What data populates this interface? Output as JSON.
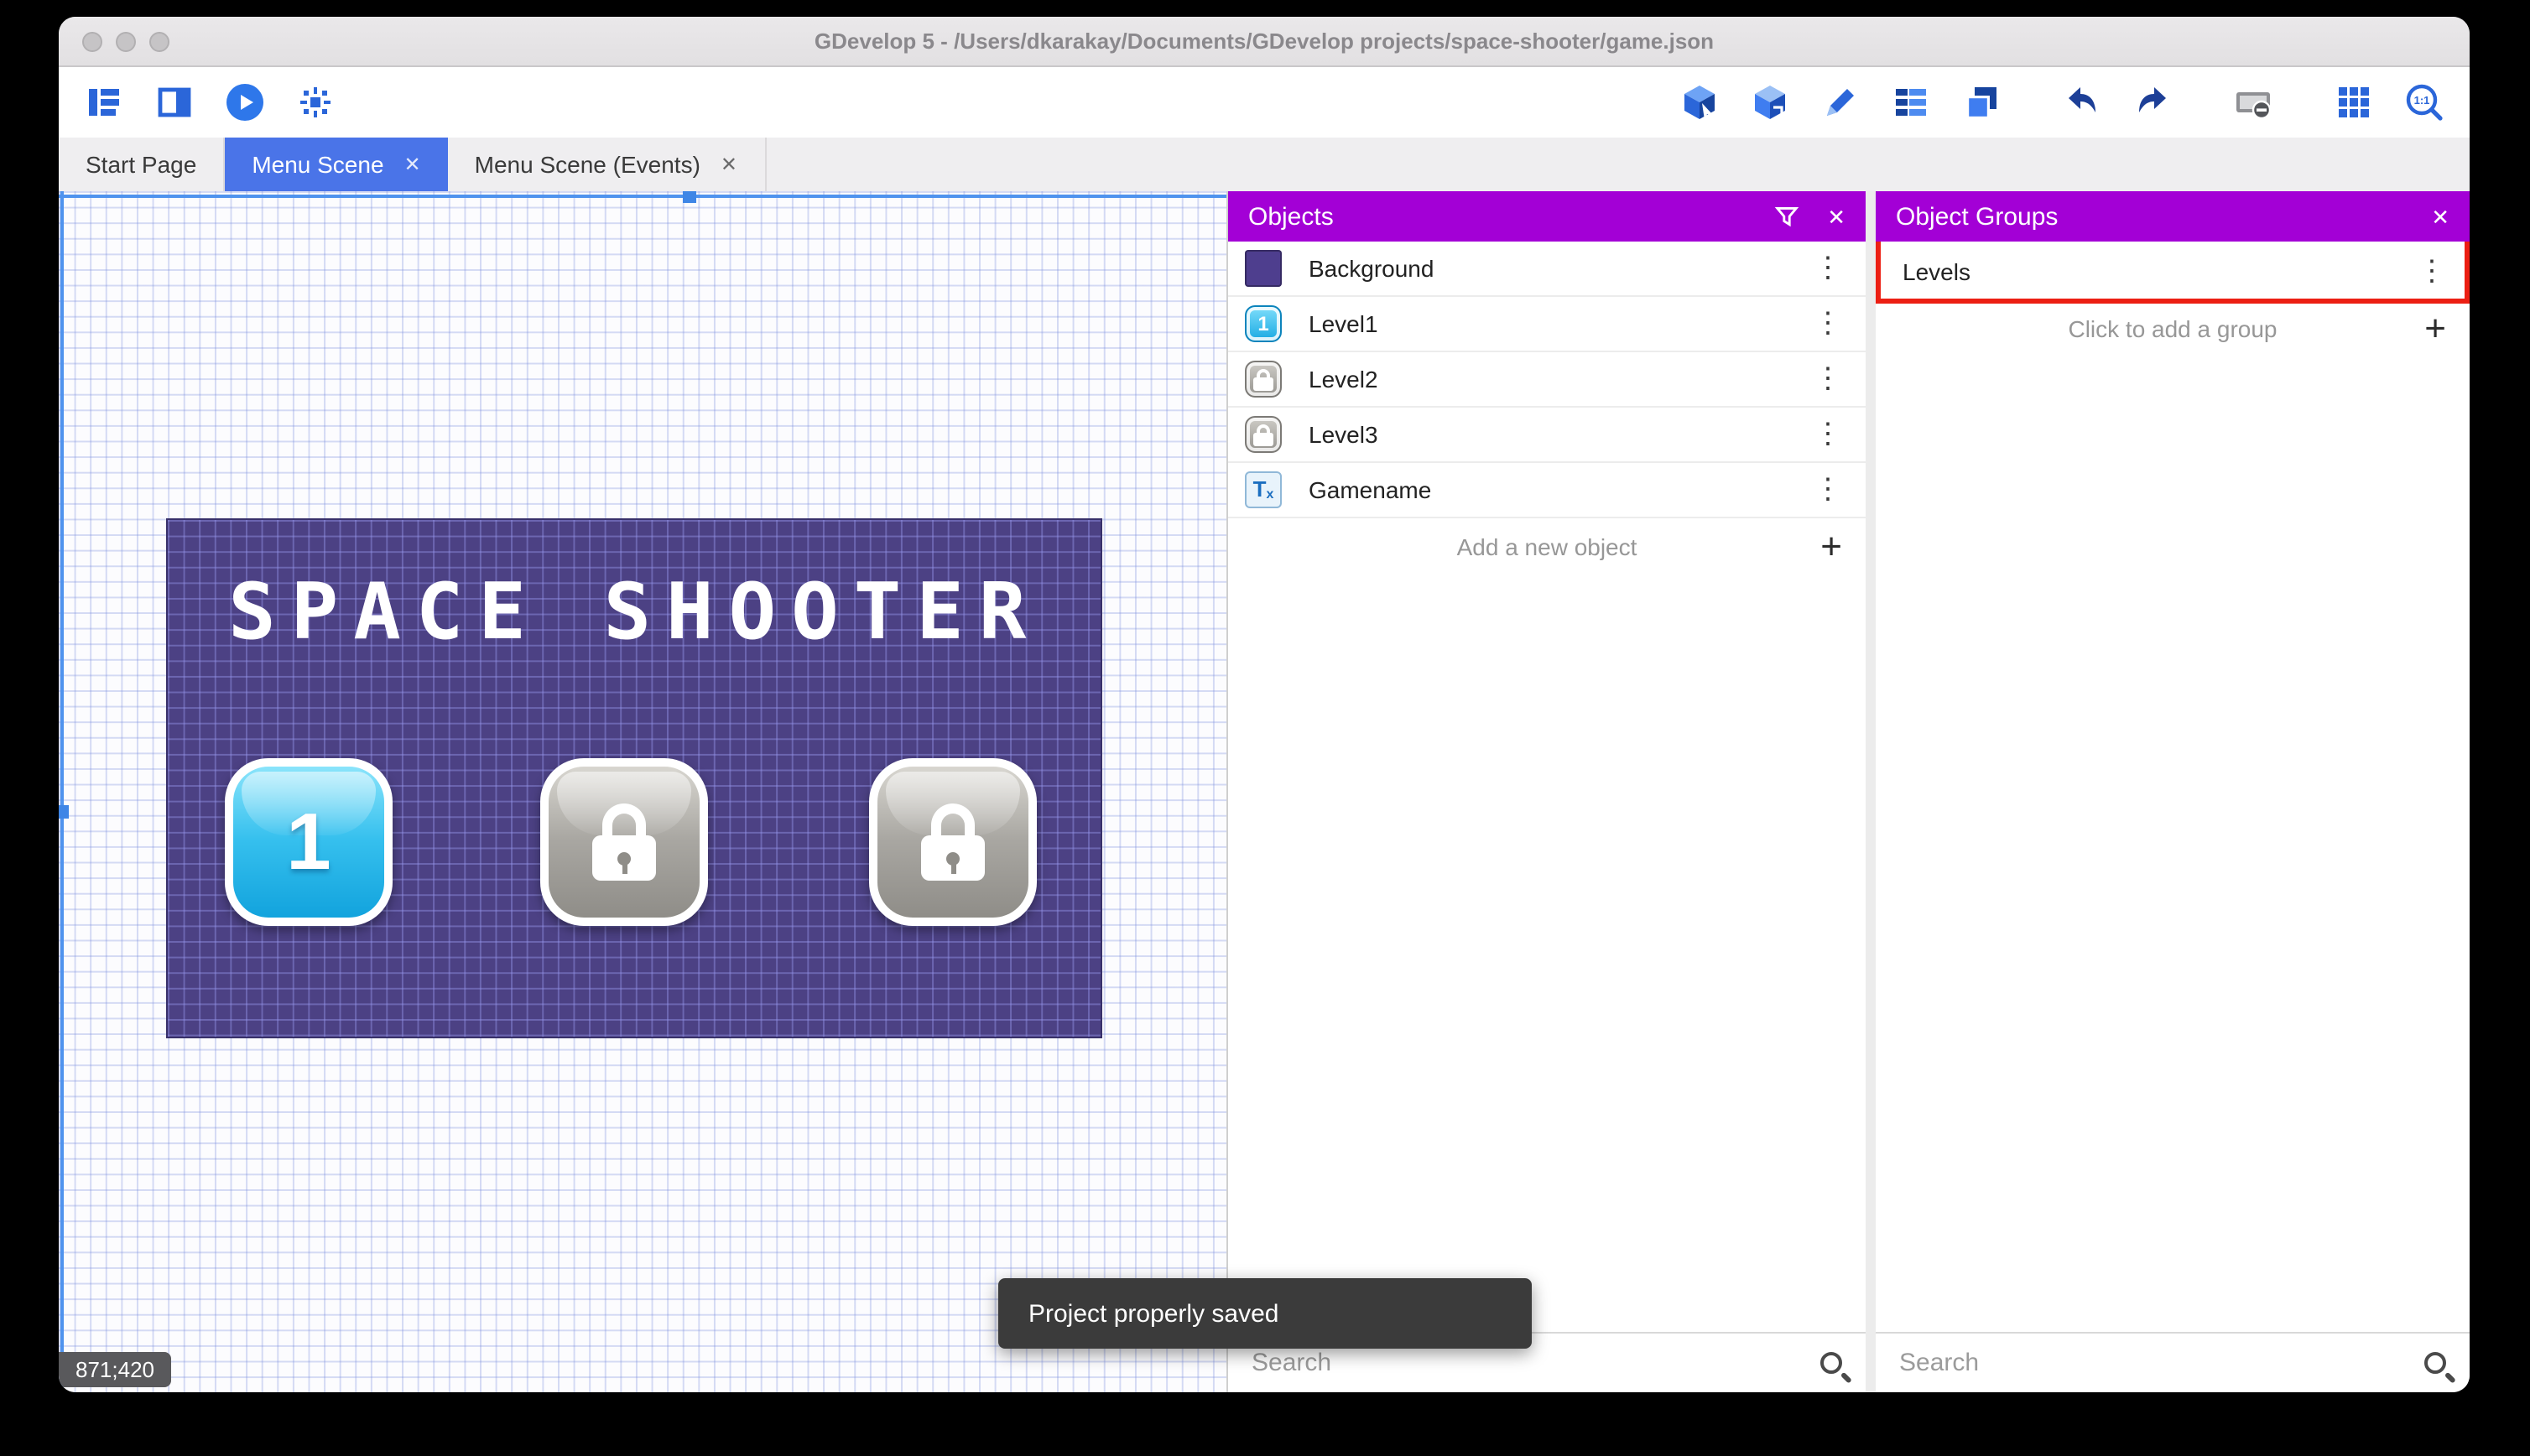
{
  "titlebar": {
    "title": "GDevelop 5 - /Users/dkarakay/Documents/GDevelop projects/space-shooter/game.json"
  },
  "tabs": {
    "items": [
      {
        "label": "Start Page"
      },
      {
        "label": "Menu Scene"
      },
      {
        "label": "Menu Scene (Events)"
      }
    ]
  },
  "canvas": {
    "coordinates": "871;420"
  },
  "scene": {
    "title": "SPACE SHOOTER",
    "level1_label": "1"
  },
  "objects_panel": {
    "title": "Objects",
    "items": [
      {
        "label": "Background"
      },
      {
        "label": "Level1",
        "badge": "1"
      },
      {
        "label": "Level2"
      },
      {
        "label": "Level3"
      },
      {
        "label": "Gamename",
        "glyph": "T",
        "glyph_sub": "x"
      }
    ],
    "add_label": "Add a new object",
    "search_placeholder": "Search"
  },
  "groups_panel": {
    "title": "Object Groups",
    "items": [
      {
        "label": "Levels"
      }
    ],
    "add_label": "Click to add a group",
    "search_placeholder": "Search"
  },
  "snackbar": {
    "message": "Project properly saved"
  },
  "colors": {
    "panel_header_purple": "#a300d6",
    "active_tab_blue": "#4a74e8",
    "annotation_red": "#ec1f13",
    "scene_purple": "#4c4184"
  }
}
